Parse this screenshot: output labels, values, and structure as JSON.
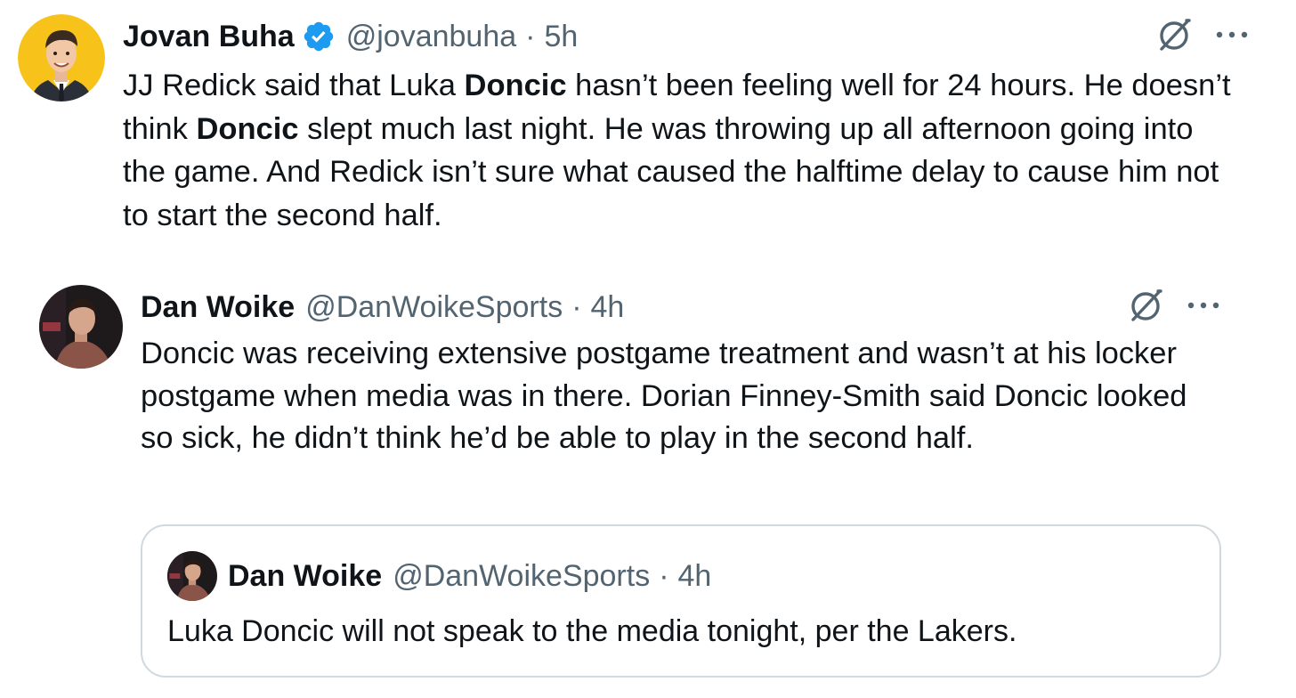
{
  "main_tweet": {
    "author_name": "Jovan Buha",
    "verified": true,
    "handle": "@jovanbuha",
    "separator": "·",
    "time": "5h",
    "text_parts": [
      {
        "t": "JJ Redick said that Luka ",
        "b": false
      },
      {
        "t": "Doncic",
        "b": true
      },
      {
        "t": " hasn’t been feeling well for 24 hours. He doesn’t think ",
        "b": false
      },
      {
        "t": "Doncic",
        "b": true
      },
      {
        "t": " slept much last night. He was throwing up all afternoon going into the game. And Redick isn’t sure what caused the halftime delay to cause him not to start the second half.",
        "b": false
      }
    ]
  },
  "reply_tweet": {
    "author_name": "Dan Woike",
    "handle": "@DanWoikeSports",
    "separator": "·",
    "time": "4h",
    "text": "Doncic was receiving extensive postgame treatment and wasn’t at his locker postgame when media was in there. Dorian Finney-Smith said Doncic looked so sick, he didn’t think he’d be able to play in the second half."
  },
  "quoted_tweet": {
    "author_name": "Dan Woike",
    "handle": "@DanWoikeSports",
    "separator": "·",
    "time": "4h",
    "text": "Luka Doncic will not speak to the media tonight, per the Lakers."
  },
  "icons": {
    "grok": "grok-icon",
    "more": "more-icon",
    "verified": "verified-badge-icon"
  },
  "colors": {
    "verified_blue": "#1d9bf0",
    "secondary_text": "#536471",
    "border": "#cfd9de",
    "avatar_bg_yellow": "#f7c31a"
  }
}
